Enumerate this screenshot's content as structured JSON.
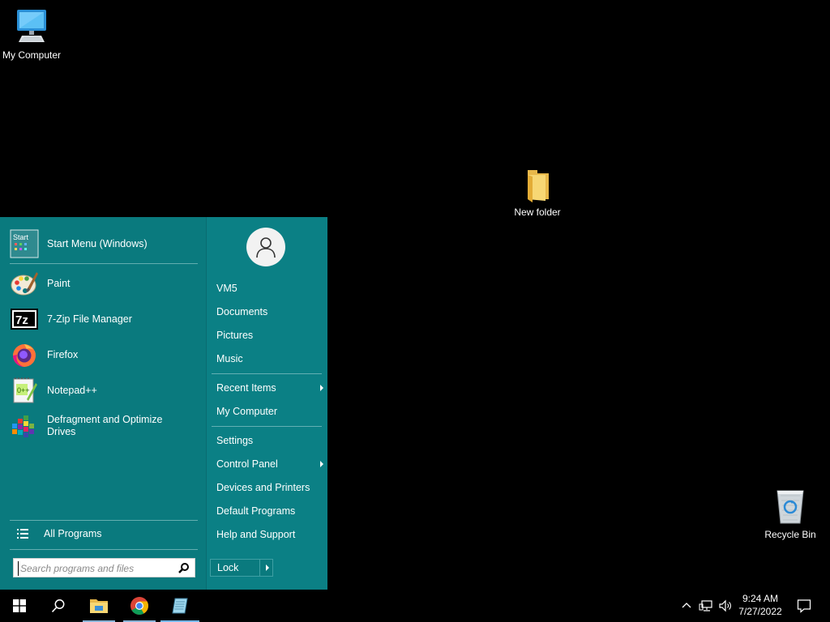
{
  "desktop": {
    "icons": [
      {
        "label": "My Computer",
        "icon": "monitor-icon"
      },
      {
        "label": "New folder",
        "icon": "folder-icon"
      },
      {
        "label": "Recycle Bin",
        "icon": "recycle-bin-icon"
      }
    ]
  },
  "start_menu": {
    "pinned": [
      {
        "label": "Start Menu (Windows)",
        "icon": "start-menu-app-icon"
      }
    ],
    "recent_programs": [
      {
        "label": "Paint",
        "icon": "paint-icon"
      },
      {
        "label": "7-Zip File Manager",
        "icon": "7zip-icon"
      },
      {
        "label": "Firefox",
        "icon": "firefox-icon"
      },
      {
        "label": "Notepad++",
        "icon": "notepadpp-icon"
      },
      {
        "label": "Defragment and Optimize Drives",
        "icon": "defrag-icon"
      }
    ],
    "all_programs_label": "All Programs",
    "search_placeholder": "Search programs and files",
    "right_pane": {
      "user": "VM5",
      "group1": [
        "Documents",
        "Pictures",
        "Music"
      ],
      "group2": [
        {
          "label": "Recent Items",
          "submenu": true
        },
        {
          "label": "My Computer",
          "submenu": false
        }
      ],
      "group3": [
        {
          "label": "Settings",
          "submenu": false
        },
        {
          "label": "Control Panel",
          "submenu": true
        },
        {
          "label": "Devices and Printers",
          "submenu": false
        },
        {
          "label": "Default Programs",
          "submenu": false
        },
        {
          "label": "Help and Support",
          "submenu": false
        }
      ],
      "lock_label": "Lock"
    },
    "colors": {
      "background": "#0a7a7e",
      "accent": "#76b9ed"
    }
  },
  "taskbar": {
    "items": [
      {
        "name": "start-button",
        "icon": "windows-logo-icon"
      },
      {
        "name": "search-button",
        "icon": "search-icon"
      },
      {
        "name": "file-explorer-button",
        "icon": "file-explorer-icon"
      },
      {
        "name": "chrome-button",
        "icon": "chrome-icon"
      },
      {
        "name": "notepad-button",
        "icon": "notepad-icon"
      }
    ],
    "tray": {
      "time": "9:24 AM",
      "date": "7/27/2022"
    }
  }
}
